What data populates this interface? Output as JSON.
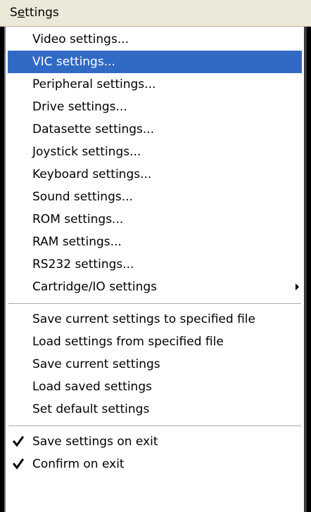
{
  "menubar": {
    "title_prefix": "S",
    "title_underlined": "e",
    "title_rest": "ttings"
  },
  "menu": {
    "items": [
      {
        "label": "Video settings..."
      },
      {
        "label": "VIC settings..."
      },
      {
        "label": "Peripheral settings..."
      },
      {
        "label": "Drive settings..."
      },
      {
        "label": "Datasette settings..."
      },
      {
        "label": "Joystick settings..."
      },
      {
        "label": "Keyboard settings..."
      },
      {
        "label": "Sound settings..."
      },
      {
        "label": "ROM settings..."
      },
      {
        "label": "RAM settings..."
      },
      {
        "label": "RS232 settings..."
      },
      {
        "label": "Cartridge/IO settings"
      },
      {
        "label": "Save current settings to specified file"
      },
      {
        "label": "Load settings from specified file"
      },
      {
        "label": "Save current settings"
      },
      {
        "label": "Load saved settings"
      },
      {
        "label": "Set default settings"
      },
      {
        "label": "Save settings on exit"
      },
      {
        "label": "Confirm on exit"
      }
    ],
    "selected_index": 1,
    "submenu_index": 11,
    "checked_indices": [
      17,
      18
    ]
  },
  "colors": {
    "selection_bg": "#316ac5",
    "selection_text": "#ffffff",
    "menu_bg": "#ffffff",
    "menubar_bg": "#ece9d8"
  },
  "icons": {
    "submenu": "triangle-right-icon",
    "check": "checkmark-icon"
  }
}
